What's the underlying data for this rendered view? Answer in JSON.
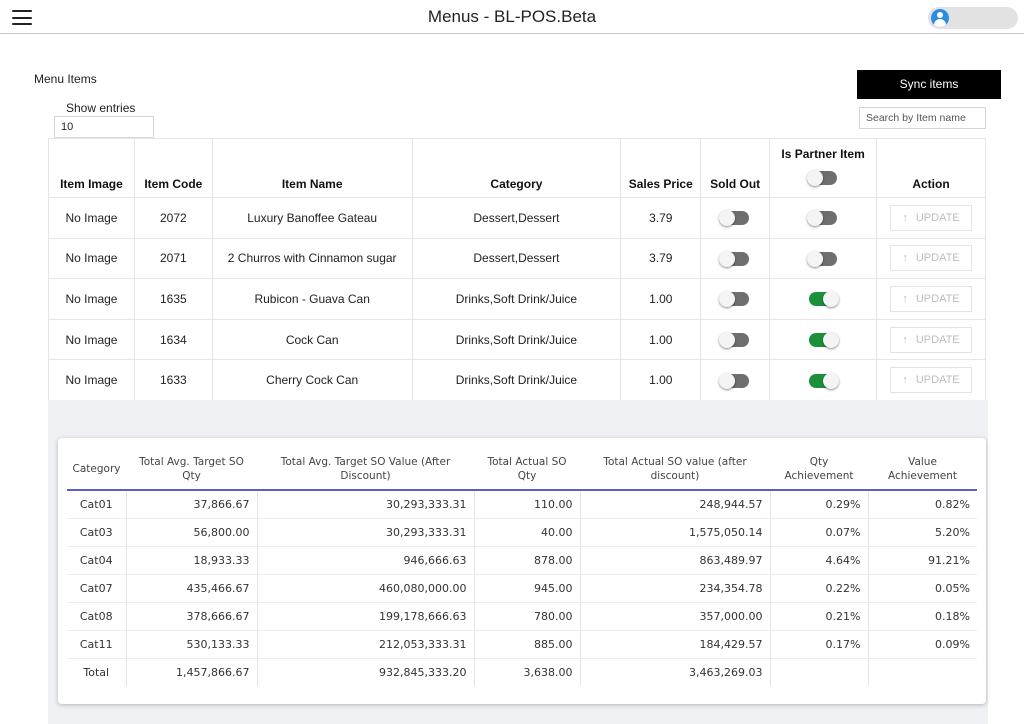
{
  "header": {
    "title": "Menus - BL-POS.Beta"
  },
  "page": {
    "section_label": "Menu Items",
    "sync_label": "Sync items",
    "show_entries_label": "Show entries",
    "entries_value": "10",
    "search_placeholder": "Search by Item name"
  },
  "items_table": {
    "headers": [
      "Item Image",
      "Item Code",
      "Item Name",
      "Category",
      "Sales Price",
      "Sold Out",
      "Is Partner Item",
      "Action"
    ],
    "partner_header_toggle_on": false,
    "update_label": "UPDATE",
    "rows": [
      {
        "image": "No Image",
        "code": "2072",
        "name": "Luxury Banoffee Gateau",
        "category": "Dessert,Dessert",
        "price": "3.79",
        "sold_out": false,
        "partner": false
      },
      {
        "image": "No Image",
        "code": "2071",
        "name": "2 Churros with Cinnamon sugar",
        "category": "Dessert,Dessert",
        "price": "3.79",
        "sold_out": false,
        "partner": false
      },
      {
        "image": "No Image",
        "code": "1635",
        "name": "Rubicon - Guava Can",
        "category": "Drinks,Soft Drink/Juice",
        "price": "1.00",
        "sold_out": false,
        "partner": true
      },
      {
        "image": "No Image",
        "code": "1634",
        "name": "Cock Can",
        "category": "Drinks,Soft Drink/Juice",
        "price": "1.00",
        "sold_out": false,
        "partner": true
      },
      {
        "image": "No Image",
        "code": "1633",
        "name": "Cherry Cock Can",
        "category": "Drinks,Soft Drink/Juice",
        "price": "1.00",
        "sold_out": false,
        "partner": true
      }
    ]
  },
  "summary_table": {
    "headers": [
      "Category",
      "Total Avg. Target SO Qty",
      "Total Avg. Target SO Value (After Discount)",
      "Total Actual SO Qty",
      "Total Actual SO value (after discount)",
      "Qty Achievement",
      "Value Achievement"
    ],
    "rows": [
      [
        "Cat01",
        "37,866.67",
        "30,293,333.31",
        "110.00",
        "248,944.57",
        "0.29%",
        "0.82%"
      ],
      [
        "Cat03",
        "56,800.00",
        "30,293,333.31",
        "40.00",
        "1,575,050.14",
        "0.07%",
        "5.20%"
      ],
      [
        "Cat04",
        "18,933.33",
        "946,666.63",
        "878.00",
        "863,489.97",
        "4.64%",
        "91.21%"
      ],
      [
        "Cat07",
        "435,466.67",
        "460,080,000.00",
        "945.00",
        "234,354.78",
        "0.22%",
        "0.05%"
      ],
      [
        "Cat08",
        "378,666.67",
        "199,178,666.63",
        "780.00",
        "357,000.00",
        "0.21%",
        "0.18%"
      ],
      [
        "Cat11",
        "530,133.33",
        "212,053,333.31",
        "885.00",
        "184,429.57",
        "0.17%",
        "0.09%"
      ],
      [
        "Total",
        "1,457,866.67",
        "932,845,333.20",
        "3,638.00",
        "3,463,269.03",
        "",
        ""
      ]
    ]
  },
  "colors": {
    "toggle_on": "#1b8f3a",
    "toggle_off": "#6f6f6f",
    "accent_underline": "#5b5fc7",
    "sync_bg": "#000000",
    "avatar": "#2a8ee0"
  }
}
